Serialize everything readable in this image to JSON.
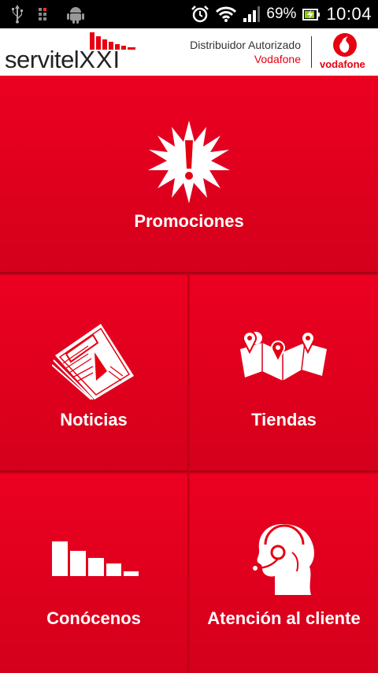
{
  "status_bar": {
    "battery_percent": "69%",
    "time": "10:04",
    "icons": [
      "usb-icon",
      "debug-icon",
      "android-icon",
      "alarm-icon",
      "wifi-icon",
      "signal-icon",
      "battery-icon"
    ]
  },
  "header": {
    "brand_text": "servitel",
    "brand_suffix": "XXI",
    "distributor_line1": "Distribuidor Autorizado",
    "distributor_line2": "Vodafone",
    "partner_name": "vodafone"
  },
  "menu": {
    "promociones": "Promociones",
    "noticias": "Noticias",
    "tiendas": "Tiendas",
    "conocenos": "Conócenos",
    "atencion": "Atención al cliente"
  },
  "colors": {
    "primary_red": "#e60012",
    "tile_top": "#ec0021",
    "tile_bottom": "#d4001b"
  }
}
